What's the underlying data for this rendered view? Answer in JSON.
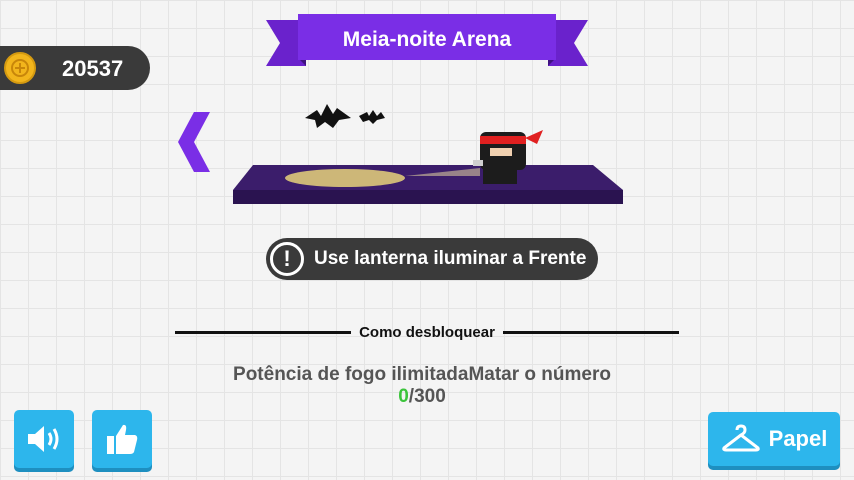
{
  "currency": {
    "amount": "20537",
    "icon": "coin-icon",
    "color": "#f2b51c"
  },
  "arena": {
    "title": "Meia-noite Arena",
    "banner_color": "#7a2ee6",
    "floor_color": "#3b1d6b"
  },
  "nav": {
    "prev_icon": "chevron-left-icon"
  },
  "hint": {
    "icon": "exclamation-icon",
    "text": "Use lanterna iluminar a Frente"
  },
  "unlock": {
    "header": "Como desbloquear",
    "description": "Potência de fogo ilimitadaMatar o número",
    "progress_current": "0",
    "progress_total": "/300"
  },
  "buttons": {
    "sound_icon": "speaker-icon",
    "like_icon": "thumbs-up-icon",
    "skin_icon": "hanger-icon",
    "skin_label": "Papel"
  },
  "theme": {
    "button_color": "#2db6ec",
    "pill_color": "#3a3a3a"
  }
}
